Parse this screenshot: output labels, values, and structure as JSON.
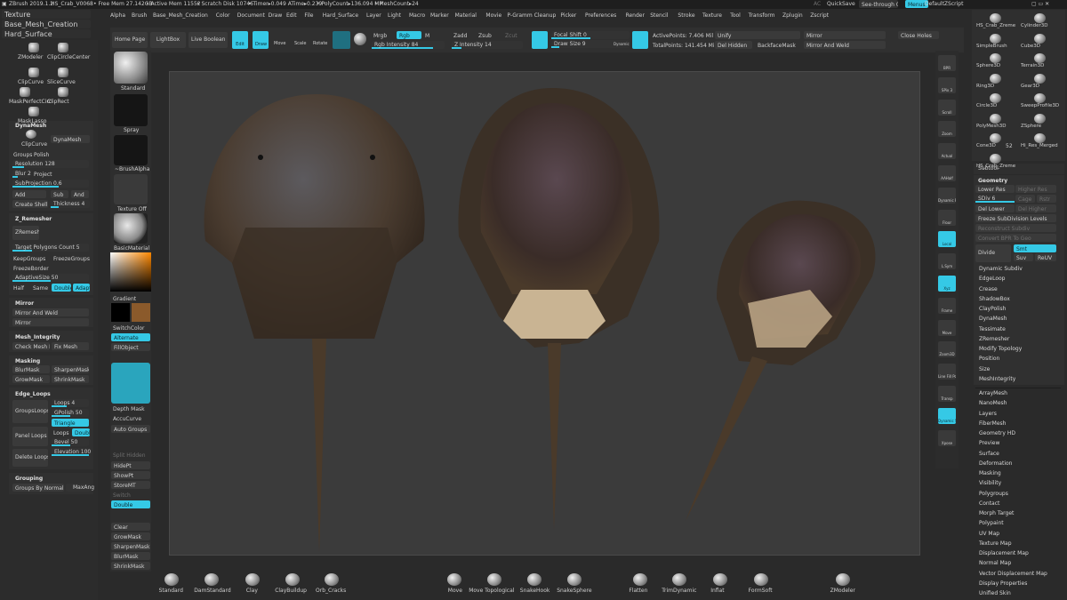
{
  "titlebar": {
    "app": "ZBrush 2019.1.2",
    "file": "HS_Crab_V0068",
    "free_mem": "• Free Mem 27.142GB",
    "active_mem": "• Active Mem 11552",
    "scratch": "• Scratch Disk 10746",
    "timer": "• Timer▸0.049 ATime▸0.239",
    "polycount": "• PolyCount▸136.094 MP",
    "meshcount": "• MeshCount▸24",
    "ac": "AC",
    "quicksave": "QuickSave",
    "see_through": "See-through  0",
    "menus": "Menus",
    "script": "DefaultZScript"
  },
  "menubar": [
    "Alpha",
    "Brush",
    "Base_Mesh_Creation",
    "Color",
    "Document",
    "Draw",
    "Edit",
    "File",
    "Hard_Surface",
    "Layer",
    "Light",
    "Macro",
    "Marker",
    "Material",
    "Movie",
    "P-Gramm Cleanup",
    "Picker",
    "Preferences",
    "Render",
    "Stencil",
    "Stroke",
    "Texture",
    "Tool",
    "Transform",
    "Zplugin",
    "Zscript"
  ],
  "top_left": {
    "texture": "Texture",
    "base_mesh": "Base_Mesh_Creation",
    "hard_surface": "Hard_Surface"
  },
  "toolbar": {
    "home": "Home Page",
    "lightbox": "LightBox",
    "live_boolean": "Live Boolean",
    "edit": "Edit",
    "draw": "Draw",
    "move": "Move",
    "scale": "Scale",
    "rotate": "Rotate",
    "mrgb": "Mrgb",
    "rgb": "Rgb",
    "m": "M",
    "rgb_intensity": "Rgb Intensity 84",
    "zadd": "Zadd",
    "zsub": "Zsub",
    "zcut": "Zcut",
    "z_intensity": "Z Intensity 14",
    "focal_shift": "Focal Shift 0",
    "draw_size": "Draw Size 9",
    "dynamic": "Dynamic",
    "active_points": "ActivePoints: 7.406 Mil",
    "total_points": "TotalPoints: 141.454 Mil",
    "unify": "Unify",
    "del_hidden": "Del Hidden",
    "backface_mask": "BackfaceMask",
    "mirror": "Mirror",
    "mirror_weld": "Mirror And Weld",
    "close_holes": "Close Holes"
  },
  "left_panel": {
    "tools": [
      "ZModeler",
      "ClipCircleCenter",
      "ClipCurve",
      "SliceCurve",
      "MaskPerfectCirc",
      "ClipRect",
      "MaskLasso"
    ],
    "dynamesh": {
      "title": "DynaMesh",
      "clipcurve": "ClipCurve",
      "dynamesh": "DynaMesh",
      "groups": "Groups",
      "polish": "Polish",
      "resolution": "Resolution 128",
      "blur": "Blur 2",
      "project": "Project",
      "subprojection": "SubProjection 0.6",
      "add": "Add",
      "sub": "Sub",
      "and": "And",
      "create_shell": "Create Shell",
      "thickness": "Thickness 4"
    },
    "zremesher": {
      "title": "Z_Remesher",
      "zremesher": "ZRemesher",
      "target": "Target Polygons Count 5",
      "keepgroups": "KeepGroups",
      "freezegroups": "FreezeGroups",
      "freezeborder": "FreezeBorder",
      "adaptive": "AdaptiveSize 50",
      "half": "Half",
      "same": "Same",
      "double": "Double",
      "adapt": "Adapt"
    },
    "mirror": {
      "title": "Mirror",
      "mirror_weld": "Mirror And Weld",
      "mirror": "Mirror"
    },
    "mesh_integrity": {
      "title": "Mesh_Integrity",
      "check": "Check Mesh Int",
      "fix": "Fix Mesh"
    },
    "masking": {
      "title": "Masking",
      "blur": "BlurMask",
      "sharpen": "SharpenMask",
      "grow": "GrowMask",
      "shrink": "ShrinkMask"
    },
    "edge_loops": {
      "title": "Edge_Loops",
      "loops": "Loops 4",
      "gpolish": "GPolish 50",
      "triangle": "Triangle",
      "loops2": "Loops",
      "double": "Double",
      "bevel": "Bevel 50",
      "elevation": "Elevation 100",
      "group_loops": "GroupsLoops",
      "panel_loops": "Panel Loops",
      "delete_loops": "Delete Loops"
    },
    "grouping": {
      "title": "Grouping",
      "by_normals": "Groups By Normals",
      "maxang": "MaxAng"
    }
  },
  "brush_column": {
    "standard": "Standard",
    "spray": "Spray",
    "brush_alpha": "~BrushAlpha",
    "texture_off": "Texture Off",
    "basic_material": "BasicMaterial",
    "gradient": "Gradient",
    "switch_color": "SwitchColor",
    "alternate": "Alternate",
    "fill_object": "FillObject",
    "depth_mask": "Depth Mask",
    "accucurve": "AccuCurve",
    "auto_groups": "Auto Groups",
    "split_hidden": "Split Hidden",
    "hidept": "HidePt",
    "showpt": "ShowPt",
    "storemt": "StoreMT",
    "switch": "Switch",
    "double": "Double",
    "clear": "Clear",
    "growmask": "GrowMask",
    "sharpenmask": "SharpenMask",
    "blurmask": "BlurMask",
    "shrinkmask": "ShrinkMask"
  },
  "right_shelf": [
    "BPR",
    "SPix 3",
    "Scroll",
    "Zoom",
    "Actual",
    "AAHalf",
    "Dynamic Persp",
    "Floor",
    "Local",
    "L.Sym",
    "Xyz",
    "Frame",
    "Move",
    "Zoom3D",
    "Line Fill PolyF",
    "Transp",
    "Dynamic Solo",
    "Xpose"
  ],
  "tool_palette": {
    "tools": [
      "HS_Crab_Zreme",
      "Cylinder3D",
      "SimpleBrush",
      "Cube3D",
      "Sphere3D",
      "Terrain3D",
      "Ring3D",
      "Gear3D",
      "Circle3D",
      "SweepProfile3D",
      "PolyMesh3D",
      "ZSphere",
      "Cone3D",
      "Hi_Res_Merged",
      "HS_Crab_Zreme"
    ],
    "count": "52"
  },
  "subtool": {
    "subtool": "Subtool",
    "geometry": "Geometry",
    "lower_res": "Lower Res",
    "higher_res": "Higher Res",
    "sdiv": "SDiv 6",
    "cage": "Cage",
    "rstr": "Rstr",
    "del_lower": "Del Lower",
    "del_higher": "Del Higher",
    "freeze": "Freeze SubDivision Levels",
    "reconstruct": "Reconstruct Subdiv",
    "convert_bpr": "Convert BPR To Geo",
    "divide": "Divide",
    "smt": "Smt",
    "suv": "Suv",
    "reuv": "ReUV"
  },
  "right_list": [
    "Dynamic Subdiv",
    "EdgeLoop",
    "Crease",
    "ShadowBox",
    "ClayPolish",
    "DynaMesh",
    "Tessimate",
    "ZRemesher",
    "Modify Topology",
    "Position",
    "Size",
    "MeshIntegrity",
    "ArrayMesh",
    "NanoMesh",
    "Layers",
    "FiberMesh",
    "Geometry HD",
    "Preview",
    "Surface",
    "Deformation",
    "Masking",
    "Visibility",
    "Polygroups",
    "Contact",
    "Morph Target",
    "Polypaint",
    "UV Map",
    "Texture Map",
    "Displacement Map",
    "Normal Map",
    "Vector Displacement Map",
    "Display Properties",
    "Unified Skin"
  ],
  "bottom_shelf": [
    "Standard",
    "DamStandard",
    "Clay",
    "ClayBuildup",
    "Orb_Cracks",
    "Move",
    "Move Topological",
    "SnakeHook",
    "SnakeSphere",
    "Flatten",
    "TrimDynamic",
    "Inflat",
    "FormSoft",
    "ZModeler"
  ],
  "colors": {
    "accent": "#35c9e6",
    "bg": "#2a2a2a",
    "canvas": "#3a3a3a"
  }
}
